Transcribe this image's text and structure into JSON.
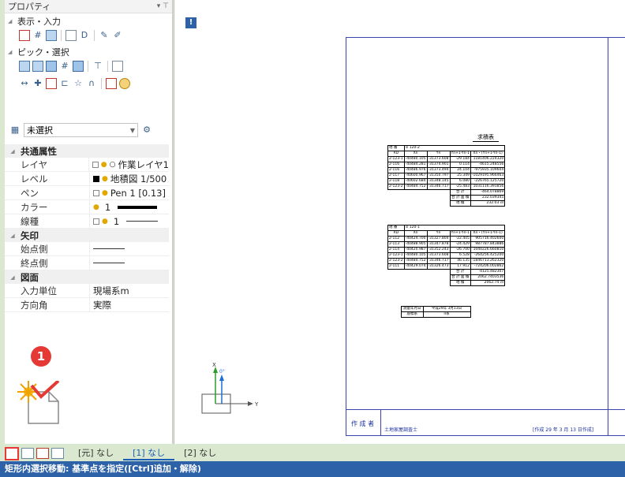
{
  "panel": {
    "title": "プロパティ",
    "sections": [
      {
        "label": "表示・入力"
      },
      {
        "label": "ピック・選択"
      }
    ],
    "filter_value": "未選択",
    "categories": [
      {
        "label": "共通属性",
        "rows": [
          {
            "key": "レイヤ",
            "value": "作業レイヤ1"
          },
          {
            "key": "レベル",
            "value": "地積図 1/500"
          },
          {
            "key": "ペン",
            "value": "Pen 1 [0.13]"
          },
          {
            "key": "カラー",
            "value": "1"
          },
          {
            "key": "線種",
            "value": "1"
          }
        ]
      },
      {
        "label": "矢印",
        "rows": [
          {
            "key": "始点側",
            "value": ""
          },
          {
            "key": "終点側",
            "value": ""
          }
        ]
      },
      {
        "label": "図面",
        "rows": [
          {
            "key": "入力単位",
            "value": "現場系m"
          },
          {
            "key": "方向角",
            "value": "実際"
          }
        ]
      }
    ]
  },
  "callout": {
    "number": "1"
  },
  "layer_tabs": [
    "[元] なし",
    "[1] なし",
    "[2] なし"
  ],
  "status_text": "矩形内選択移動: 基準点を指定([Ctrl]追加・解除)",
  "canvas": {
    "info_icon": "!",
    "table_title": "求積表",
    "table1": {
      "header": [
        "地 番",
        "120-2"
      ],
      "cols": [
        "RD",
        "Xn",
        "Yn",
        "Yn+1-Yn-1",
        "Xn・(Yn+1-Yn-1)"
      ],
      "rows": [
        [
          "2-123-1",
          "-40480.105",
          "-31373.608",
          "-29.184",
          "1181406.224320"
        ],
        [
          "2-116",
          "-40484.281",
          "-31374.901",
          "0.114",
          "-4615.248556"
        ],
        [
          "2-116",
          "-40486.976",
          "-31373.494",
          "24.104",
          "-975935.109604"
        ],
        [
          "2-117",
          "-40600.967",
          "-31350.797",
          "25.349",
          "-1029195.966463"
        ],
        [
          "2-118",
          "-40602.684",
          "-31348.145",
          "6.080",
          "-226765.125720"
        ],
        [
          "2-123-2",
          "-40484.752",
          "-31346.717",
          "-25.483",
          "1031116.391856"
        ]
      ],
      "sum_label1": "合 計",
      "sum_value1": "-464.078869",
      "sum_label2": "合 計 面 積",
      "sum_value2": "232.039345",
      "area_label": "地 積",
      "area_value": "232.03",
      "unit": "㎡"
    },
    "table2": {
      "header": [
        "地 番",
        "120-1"
      ],
      "cols": [
        "RD",
        "Xn",
        "Yn",
        "Yn+1-Yn-1",
        "Xn・(Yn+1-Yn-1)"
      ],
      "rows": [
        [
          "2-112",
          "-40424.700",
          "-31327.804",
          "-22.405",
          "905716.402600"
        ],
        [
          "2-113",
          "-40488.905",
          "-31347.878",
          "-24.429",
          "987787.843886"
        ],
        [
          "2-114",
          "-40420.987",
          "-31352.243",
          "-26.700",
          "1040226.660810"
        ],
        [
          "2-123-1",
          "-40480.105",
          "-31373.608",
          "6.528",
          "-264256.425200"
        ],
        [
          "2-123-2",
          "-40484.752",
          "-31346.717",
          "46.135",
          "-1846713.262320"
        ],
        [
          "2-111",
          "-40429.074",
          "-31326.473",
          "17.912",
          "-724206.002862"
        ]
      ],
      "sum_label1": "合 計",
      "sum_value1": "-4125.482307",
      "sum_label2": "合 計 面 積",
      "sum_value2": "2062.7403536",
      "area_label": "地 積",
      "area_value": "2062.74",
      "unit": "㎡"
    },
    "info_table": [
      [
        "測量年月日",
        "平成29年 3月13日"
      ],
      [
        "座標系",
        "II系"
      ]
    ],
    "title_block": {
      "author_label": "作 成 者",
      "sign": "土地家屋調査士",
      "date": "[作成 29 年 3 月 13 日作成]"
    },
    "axis": {
      "x_label": "X",
      "angle": "0°",
      "y_label": "Y"
    }
  }
}
